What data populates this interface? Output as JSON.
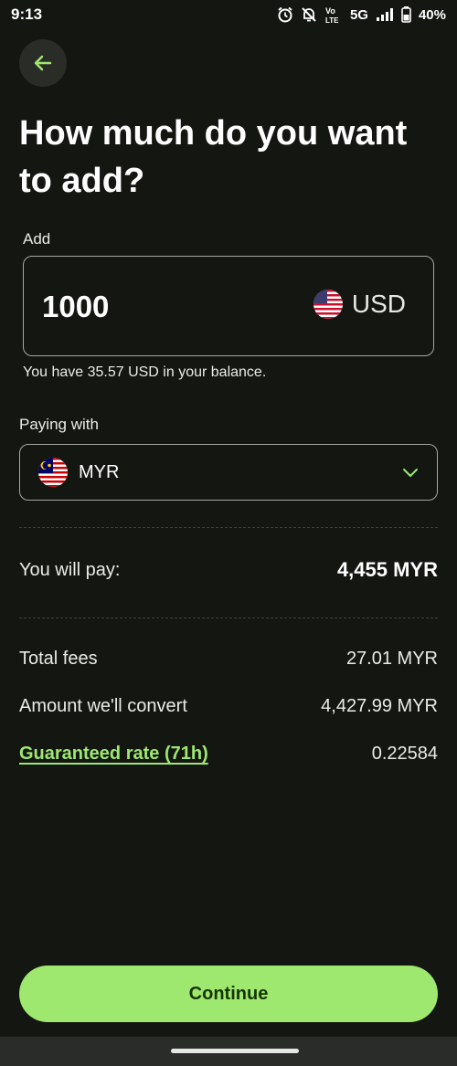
{
  "status_bar": {
    "time": "9:13",
    "network": "5G",
    "battery": "40%",
    "icons": [
      "alarm-icon",
      "mute-icon",
      "volte-icon",
      "signal-icon",
      "battery-icon"
    ]
  },
  "header": {
    "back_icon": "arrow-left-icon",
    "title": "How much do you want to add?"
  },
  "add": {
    "label": "Add",
    "amount": "1000",
    "currency": "USD",
    "currency_flag": "us-flag-icon",
    "balance_note": "You have 35.57 USD in your balance."
  },
  "paying": {
    "label": "Paying with",
    "currency": "MYR",
    "currency_flag": "my-flag-icon",
    "chevron_icon": "chevron-down-icon"
  },
  "summary": {
    "you_will_pay_label": "You will pay:",
    "you_will_pay_value": "4,455 MYR",
    "rows": [
      {
        "label": "Total fees",
        "value": "27.01 MYR"
      },
      {
        "label": "Amount we'll convert",
        "value": "4,427.99 MYR"
      },
      {
        "label": "Guaranteed rate (71h)",
        "value": "0.22584"
      }
    ]
  },
  "footer": {
    "continue_label": "Continue"
  },
  "colors": {
    "background": "#141612",
    "accent": "#9fe870",
    "accent_text": "#163300",
    "border": "#a3a8a0"
  }
}
